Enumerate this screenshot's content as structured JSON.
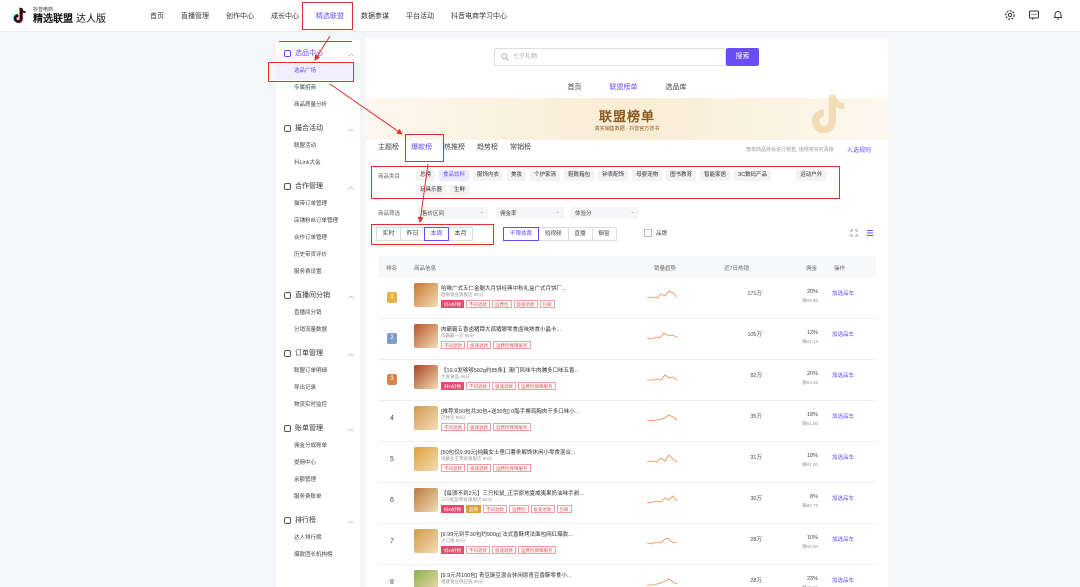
{
  "app": {
    "logo_small": "抖音电商",
    "logo_main": "精选联盟",
    "logo_sub": "达人版"
  },
  "nav": [
    "首页",
    "直播管理",
    "创作中心",
    "成长中心",
    "精选联盟",
    "数据参谋",
    "平台活动",
    "抖音电商学习中心"
  ],
  "nav_active": "精选联盟",
  "sidebar": [
    {
      "title": "选品中心",
      "items": [
        "选品广场",
        "专属招商",
        "商品质量分析"
      ]
    },
    {
      "title": "撮合活动",
      "items": [
        "联盟活动",
        "抖Link大会"
      ]
    },
    {
      "title": "合作管理",
      "items": [
        "猫带订单管理",
        "店铺粉丝订单管理",
        "合作订单管理",
        "历史带货评价",
        "服务费设置"
      ]
    },
    {
      "title": "直播间分销",
      "items": [
        "直播间分销",
        "分销流量数据"
      ]
    },
    {
      "title": "订单管理",
      "items": [
        "联盟订单明细",
        "导出记录",
        "物流实时监控"
      ]
    },
    {
      "title": "账单管理",
      "items": [
        "佣金分成账单",
        "提佣中心",
        "余额管理",
        "服务费账单"
      ]
    },
    {
      "title": "排行榜",
      "items": [
        "达人排行榜",
        "爆款团长机构榜"
      ]
    }
  ],
  "search": {
    "placeholder": "七夕礼物",
    "button": "搜索"
  },
  "subtabs": [
    "首页",
    "联盟榜单",
    "选品库"
  ],
  "banner": {
    "title": "联盟榜单",
    "subtitle": "真实销售数据 · 抖音官方背书"
  },
  "rank_tabs": [
    "主题榜",
    "爆款榜",
    "热推榜",
    "趋势榜",
    "常销榜"
  ],
  "rules_note": "榜单商品将会进行核查, 违规将实时清除",
  "rules_link": "入选规则",
  "category_label": "商品类目",
  "categories": [
    "总榜",
    "食品饮料",
    "服饰内衣",
    "美妆",
    "个护家清",
    "鞋靴箱包",
    "钟表配饰",
    "母婴宠物",
    "图书教育",
    "智能家居",
    "3C数码产品",
    "运动户外",
    "玩具乐器",
    "生鲜"
  ],
  "filter_label": "商品筛选",
  "filters": [
    "售价区间",
    "佣金率",
    "体验分"
  ],
  "time_buttons": [
    "实时",
    "昨日",
    "本周",
    "本月"
  ],
  "content_buttons": [
    "不限体裁",
    "短视频",
    "直播",
    "橱窗"
  ],
  "brand_label": "品牌",
  "table": {
    "headers": [
      "排名",
      "商品信息",
      "销量趋势",
      "近7日热销",
      "佣金",
      "操作"
    ],
    "rows": [
      {
        "rank": "1",
        "name": "哈啾广式五仁金腿大月饼经典中秋礼盒广式月饼厂...",
        "shop": "哈啾食品旗舰店 96分",
        "tags": [
          "抖in好物",
          "不同退款",
          "运费险",
          "极速退款",
          "包邮"
        ],
        "sales": "171万",
        "commission": "20%",
        "earn": "赚¥9.96",
        "op": "加选品车"
      },
      {
        "rank": "2",
        "name": "肉霸霸五香卤猪蹄大孤猪脚零食卤味熟食小晶卡...",
        "shop": "肉霸霸一店 96分",
        "tags": [
          "不同退款",
          "极速退款",
          "运费险保障服务"
        ],
        "sales": "105万",
        "commission": "12%",
        "earn": "赚¥1.19",
        "op": "加选品车"
      },
      {
        "rank": "3",
        "name": "【19.9发够够502g约85条】澳门风味牛肉脯多口味五香...",
        "shop": "大发食品 96分",
        "tags": [
          "抖in好物",
          "不同退款",
          "极速退款",
          "运费险保障服务"
        ],
        "sales": "82万",
        "commission": "20%",
        "earn": "赚¥3.98",
        "op": "加选品车"
      },
      {
        "rank": "4",
        "name": "[推荐发60包共30包+送30包] 0脂手撕鸡胸肉干多口味小...",
        "shop": "巴林签 90分",
        "tags": [
          "不同退款",
          "极速退款",
          "运费险保障服务"
        ],
        "sales": "35万",
        "commission": "18%",
        "earn": "赚¥1.80",
        "op": "加选品车"
      },
      {
        "rank": "5",
        "name": "[50包仅9.99元]纯藕女士里口薯条解馋休闲小零食混合...",
        "shop": "纯藕女王零食旗舰店 90分",
        "tags": [
          "不同退款",
          "极速退款",
          "运费险保障服务"
        ],
        "sales": "31万",
        "commission": "18%",
        "earn": "赚¥1.80",
        "op": "加选品车"
      },
      {
        "rank": "6",
        "name": "【每颁不到2元】三只松鼠_正宗原地夏威夷果奶油味手剥...",
        "shop": "三只松鼠零食旗舰店 92分",
        "tags": [
          "抖in好物",
          "品牌",
          "不同退款",
          "运费险",
          "极速退款",
          "包邮"
        ],
        "sales": "30万",
        "commission": "8%",
        "earn": "赚¥0.79",
        "op": "加选品车"
      },
      {
        "rank": "7",
        "name": "[9.99元到手30包约900g] 法式香酥烤法面包网红爆款...",
        "shop": "大口福 92分",
        "tags": [
          "抖in好物",
          "不同退款",
          "极速退款",
          "运费险保障服务"
        ],
        "sales": "28万",
        "commission": "10%",
        "earn": "赚¥0.80",
        "op": "加选品车"
      },
      {
        "rank": "8",
        "name": "[9.9元共100包] 青豆豌豆混合休闲原青豆香酥零食小...",
        "shop": "福建青豆供应链 86分",
        "tags": [
          "不同退款",
          "极速退款",
          "运费险保障服务"
        ],
        "sales": "28万",
        "commission": "23%",
        "earn": "赚¥2.28",
        "op": "加选品车"
      }
    ]
  },
  "colors": {
    "accent": "#6a4cf5",
    "highlight": "#e03030",
    "gold": "#d9a23b"
  }
}
